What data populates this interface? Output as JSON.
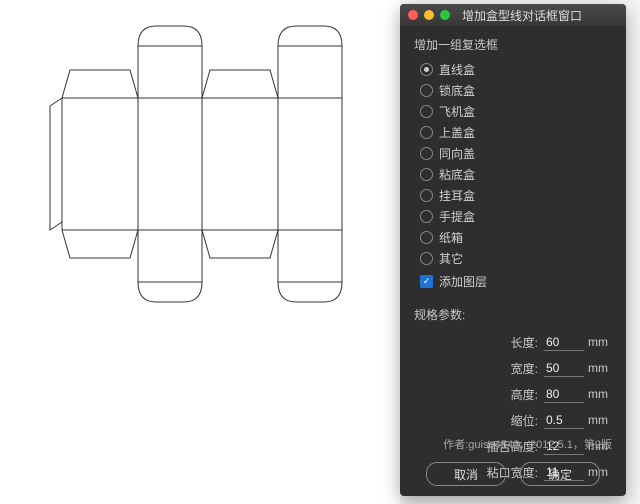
{
  "dialog": {
    "title": "增加盒型线对话框窗口",
    "group_label": "增加一组复选框",
    "options": [
      {
        "label": "直线盒",
        "selected": true
      },
      {
        "label": "锁底盒",
        "selected": false
      },
      {
        "label": "飞机盒",
        "selected": false
      },
      {
        "label": "上盖盒",
        "selected": false
      },
      {
        "label": "同向盖",
        "selected": false
      },
      {
        "label": "粘底盒",
        "selected": false
      },
      {
        "label": "挂耳盒",
        "selected": false
      },
      {
        "label": "手提盒",
        "selected": false
      },
      {
        "label": "纸箱",
        "selected": false
      },
      {
        "label": "其它",
        "selected": false
      }
    ],
    "add_layer_label": "添加图层",
    "add_layer_checked": true,
    "params_label": "规格参数:",
    "params": [
      {
        "label": "长度:",
        "value": "60",
        "unit": "mm"
      },
      {
        "label": "宽度:",
        "value": "50",
        "unit": "mm"
      },
      {
        "label": "高度:",
        "value": "80",
        "unit": "mm"
      },
      {
        "label": "缩位:",
        "value": "0.5",
        "unit": "mm"
      },
      {
        "label": "插舌高度:",
        "value": "12",
        "unit": "mm"
      },
      {
        "label": "粘口宽度:",
        "value": "11",
        "unit": "mm"
      }
    ],
    "author": "作者:guise4543，2012.5.1，第2版",
    "cancel": "取消",
    "ok": "确定"
  }
}
